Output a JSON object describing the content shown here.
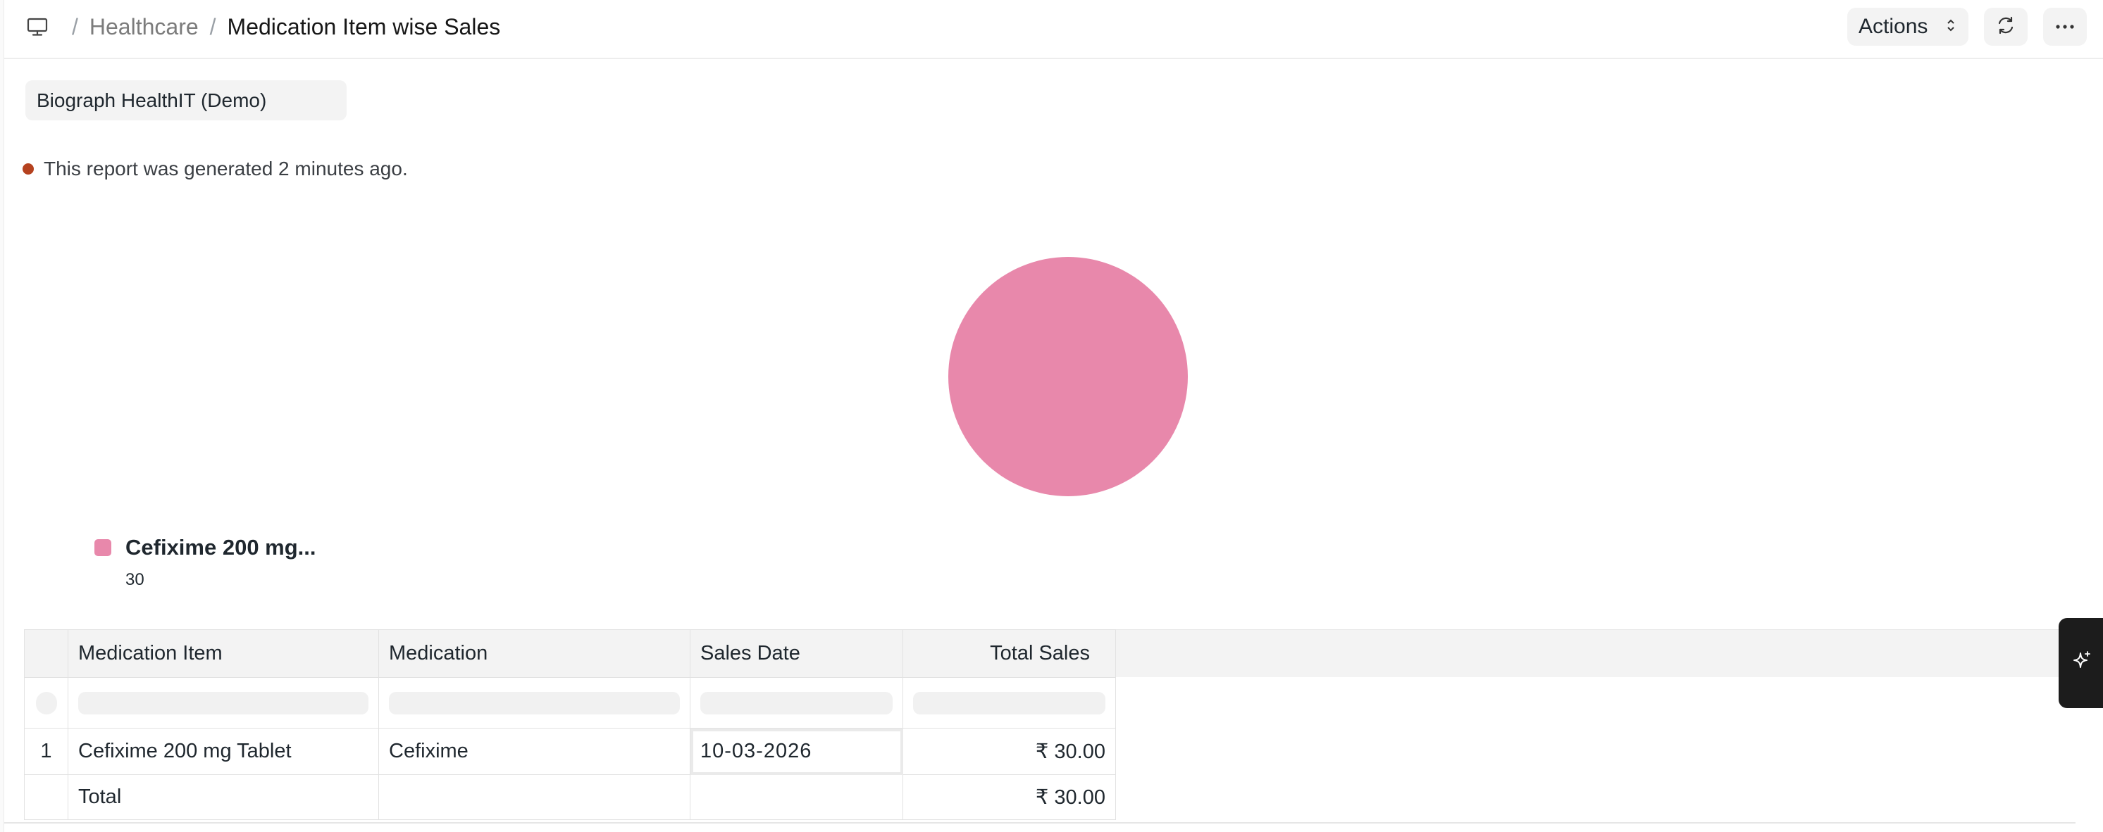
{
  "breadcrumb": {
    "parent": "Healthcare",
    "separator": "/",
    "current": "Medication Item wise Sales"
  },
  "toolbar": {
    "actions_label": "Actions",
    "icons": [
      "refresh-icon",
      "more-horizontal-icon"
    ]
  },
  "filters": {
    "company": "Biograph HealthIT (Demo)"
  },
  "status": {
    "message": "This report was generated 2 minutes ago.",
    "dot_color": "#b5421f"
  },
  "chart_data": {
    "type": "pie",
    "categories": [
      "Cefixime 200 mg..."
    ],
    "values": [
      30
    ],
    "colors": [
      "#e888ab"
    ],
    "legend": [
      {
        "label": "Cefixime 200 mg...",
        "value": "30"
      }
    ],
    "legend_position": "bottom-left"
  },
  "table": {
    "columns": [
      "Medication Item",
      "Medication",
      "Sales Date",
      "Total Sales"
    ],
    "rows": [
      {
        "index": "1",
        "medication_item": "Cefixime 200 mg Tablet",
        "medication": "Cefixime",
        "sales_date": "10-03-2026",
        "total_sales": "₹ 30.00"
      }
    ],
    "total": {
      "label": "Total",
      "total_sales": "₹ 30.00"
    }
  },
  "colors": {
    "accent": "#1c1c1c",
    "header_bg": "#f3f3f3",
    "slice": "#e888ab"
  }
}
